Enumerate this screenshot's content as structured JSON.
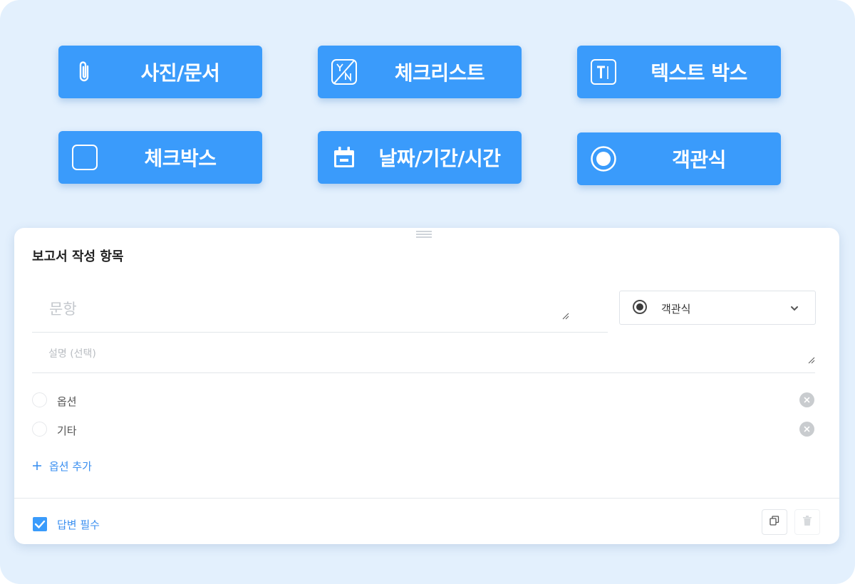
{
  "question_types": [
    {
      "label": "사진/문서",
      "icon": "paperclip-icon"
    },
    {
      "label": "체크리스트",
      "icon": "yes-no-icon"
    },
    {
      "label": "텍스트 박스",
      "icon": "text-box-icon"
    },
    {
      "label": "체크박스",
      "icon": "checkbox-icon"
    },
    {
      "label": "날짜/기간/시간",
      "icon": "calendar-icon"
    },
    {
      "label": "객관식",
      "icon": "radio-icon"
    }
  ],
  "card": {
    "title": "보고서 작성 항목",
    "question_placeholder": "문항",
    "description_placeholder": "설명 (선택)",
    "type_select": {
      "selected": "객관식",
      "icon": "radio-icon"
    },
    "options": [
      {
        "label": "옵션"
      },
      {
        "label": "기타"
      }
    ],
    "add_option_label": "옵션 추가",
    "required_label": "답변 필수",
    "required_checked": true
  },
  "colors": {
    "background": "#e3f0fd",
    "button_blue": "#3a9bfb",
    "link_blue": "#3a8ff0"
  }
}
